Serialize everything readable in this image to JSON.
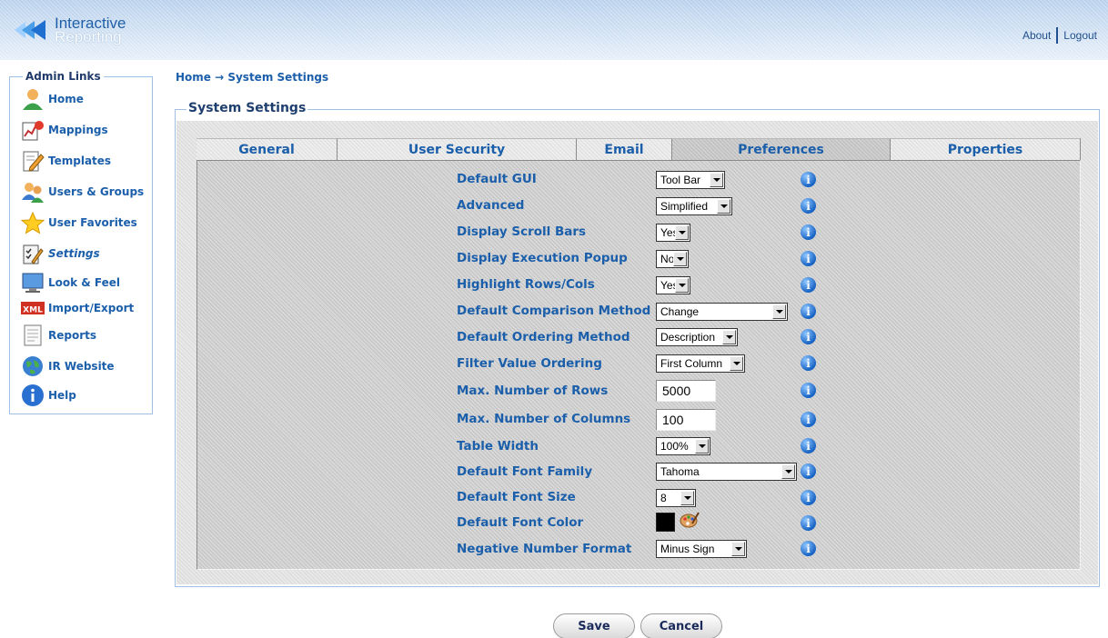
{
  "header": {
    "logo_line1": "Interactive",
    "logo_line2": "Reporting",
    "about_label": "About",
    "logout_label": "Logout"
  },
  "sidebar": {
    "title": "Admin Links",
    "items": [
      {
        "label": "Home",
        "icon": "user-icon"
      },
      {
        "label": "Mappings",
        "icon": "mappings-icon"
      },
      {
        "label": "Templates",
        "icon": "templates-icon"
      },
      {
        "label": "Users & Groups",
        "icon": "users-groups-icon"
      },
      {
        "label": "User Favorites",
        "icon": "star-icon"
      },
      {
        "label": "Settings",
        "icon": "settings-icon"
      },
      {
        "label": "Look & Feel",
        "icon": "monitor-icon"
      },
      {
        "label": "Import/Export",
        "icon": "xml-icon",
        "icon_text": "XML"
      },
      {
        "label": "Reports",
        "icon": "reports-icon"
      },
      {
        "label": "IR Website",
        "icon": "globe-icon"
      },
      {
        "label": "Help",
        "icon": "help-icon"
      }
    ]
  },
  "breadcrumb": "Home → System Settings",
  "settings": {
    "title": "System Settings",
    "tabs": [
      "General",
      "User Security",
      "Email",
      "Preferences",
      "Properties"
    ],
    "active_tab": "Preferences",
    "rows": [
      {
        "label": "Default GUI",
        "value": "Tool Bar"
      },
      {
        "label": "Advanced",
        "value": "Simplified"
      },
      {
        "label": "Display Scroll Bars",
        "value": "Yes"
      },
      {
        "label": "Display Execution Popup",
        "value": "No"
      },
      {
        "label": "Highlight Rows/Cols",
        "value": "Yes"
      },
      {
        "label": "Default Comparison Method",
        "value": "Change"
      },
      {
        "label": "Default Ordering Method",
        "value": "Description"
      },
      {
        "label": "Filter Value Ordering",
        "value": "First Column"
      },
      {
        "label": "Max. Number of Rows",
        "value": "5000"
      },
      {
        "label": "Max. Number of Columns",
        "value": "100"
      },
      {
        "label": "Table Width",
        "value": "100%"
      },
      {
        "label": "Default Font Family",
        "value": "Tahoma"
      },
      {
        "label": "Default Font Size",
        "value": "8"
      },
      {
        "label": "Default Font Color",
        "value": "",
        "color": "#000000"
      },
      {
        "label": "Negative Number Format",
        "value": "Minus Sign"
      }
    ]
  },
  "buttons": {
    "save": "Save",
    "cancel": "Cancel"
  }
}
